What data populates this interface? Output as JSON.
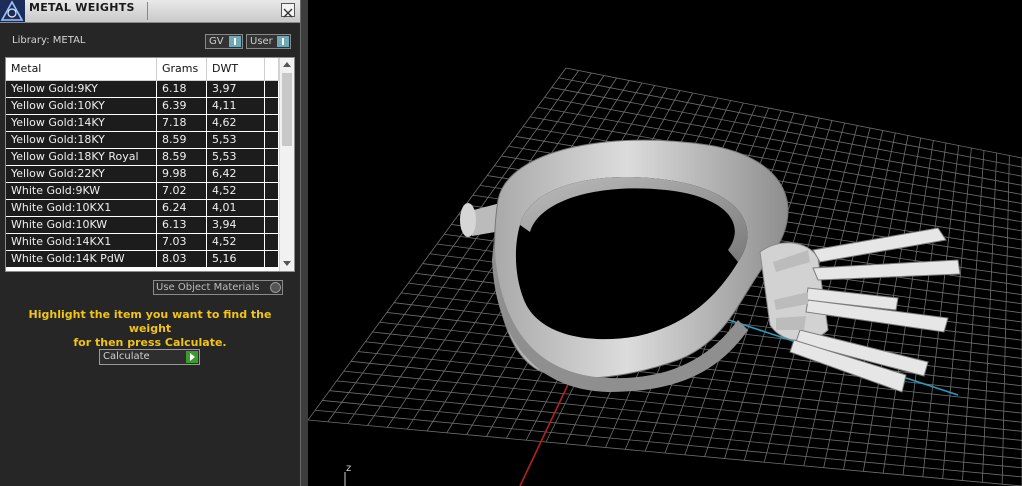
{
  "window": {
    "title": "METAL WEIGHTS",
    "library_label": "Library: METAL",
    "gv_button": "GV",
    "user_button": "User"
  },
  "table": {
    "headers": [
      "Metal",
      "Grams",
      "DWT"
    ],
    "rows": [
      {
        "metal": "Yellow Gold:9KY",
        "grams": "6.18",
        "dwt": "3,97"
      },
      {
        "metal": "Yellow Gold:10KY",
        "grams": "6.39",
        "dwt": "4,11"
      },
      {
        "metal": "Yellow Gold:14KY",
        "grams": "7.18",
        "dwt": "4,62"
      },
      {
        "metal": "Yellow Gold:18KY",
        "grams": "8.59",
        "dwt": "5,53"
      },
      {
        "metal": "Yellow Gold:18KY Royal",
        "grams": "8.59",
        "dwt": "5,53"
      },
      {
        "metal": "Yellow Gold:22KY",
        "grams": "9.98",
        "dwt": "6,42"
      },
      {
        "metal": "White Gold:9KW",
        "grams": "7.02",
        "dwt": "4,52"
      },
      {
        "metal": "White Gold:10KX1",
        "grams": "6.24",
        "dwt": "4,01"
      },
      {
        "metal": "White Gold:10KW",
        "grams": "6.13",
        "dwt": "3,94"
      },
      {
        "metal": "White Gold:14KX1",
        "grams": "7.03",
        "dwt": "4,52"
      },
      {
        "metal": "White Gold:14K PdW",
        "grams": "8.03",
        "dwt": "5,16"
      }
    ]
  },
  "options": {
    "use_object_materials": "Use Object Materials"
  },
  "hint": {
    "line1": "Highlight the item you want to find the weight",
    "line2": "for then press Calculate."
  },
  "calculate_button": "Calculate",
  "viewport": {
    "axis_label": "z"
  },
  "colors": {
    "hint_text": "#f0c419",
    "panel_bg": "#262626",
    "row_bg": "#1c1c1c",
    "grid": "#6e6e6e",
    "axis_red": "#b52222",
    "axis_cyan": "#2b9bbd"
  }
}
